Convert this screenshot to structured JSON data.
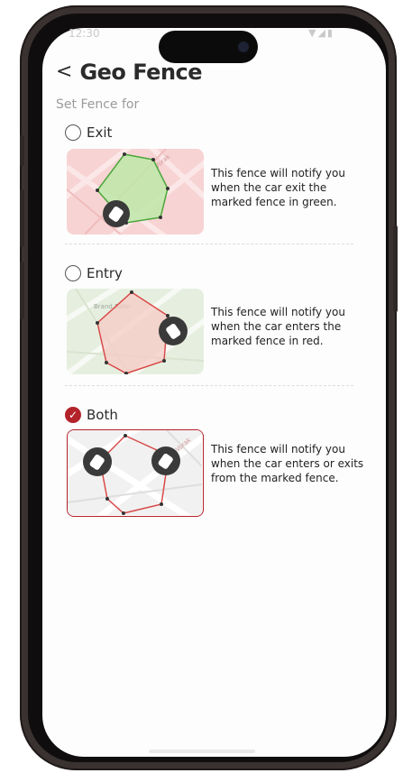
{
  "status_bar": {
    "time": "12:30",
    "icons": "▼◢▮"
  },
  "header": {
    "back_icon": "chevron-left-icon",
    "back_glyph": "<",
    "title": "Geo Fence"
  },
  "subtitle": "Set Fence for",
  "options": [
    {
      "label": "Exit",
      "checked": false,
      "description": "This fence will notify you when the car exit the marked fence in green.",
      "map_bg": "#f7d3d3",
      "fence_color": "#4aa63a",
      "fence_fill": "#bde7a8"
    },
    {
      "label": "Entry",
      "checked": false,
      "description": "This fence will notify you when the car enters the marked fence in red.",
      "map_bg": "#e6efdf",
      "fence_color": "#d94b4b",
      "fence_fill": "#f5cbc6"
    },
    {
      "label": "Both",
      "checked": true,
      "description": "This fence will notify you when the car enters or exits from the marked fence.",
      "map_bg": "#f1f1f1",
      "fence_color": "#d94b4b",
      "fence_fill": "#ffffff"
    }
  ],
  "colors": {
    "accent": "#b3232a",
    "text": "#2b2b2b",
    "muted": "#9a9a9a"
  }
}
